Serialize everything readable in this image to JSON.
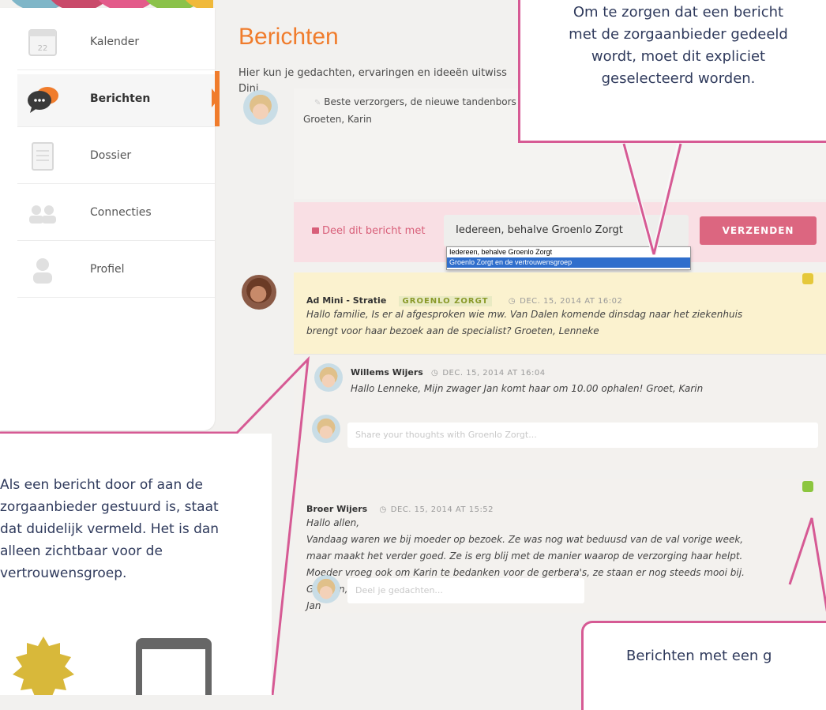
{
  "sidebar": {
    "items": [
      {
        "label": "Kalender",
        "icon": "calendar-icon",
        "active": false
      },
      {
        "label": "Berichten",
        "icon": "speech-bubbles-icon",
        "active": true
      },
      {
        "label": "Dossier",
        "icon": "notepad-icon",
        "active": false
      },
      {
        "label": "Connecties",
        "icon": "people-icon",
        "active": false
      },
      {
        "label": "Profiel",
        "icon": "person-icon",
        "active": false
      }
    ]
  },
  "calendar_icon_day": "22",
  "page": {
    "title": "Berichten",
    "description": "Hier kun je gedachten, ervaringen en ideeën uitwiss\nDini."
  },
  "compose": {
    "text_line1": "Beste verzorgers, de nieuwe tandenbors",
    "text_line2": "Groeten, Karin"
  },
  "share": {
    "label": "Deel dit bericht met",
    "selected": "Iedereen, behalve Groenlo Zorgt",
    "options": [
      "Iedereen, behalve Groenlo Zorgt",
      "Groenlo Zorgt en de vertrouwensgroep"
    ],
    "send_label": "VERZENDEN"
  },
  "messages": [
    {
      "author": "Ad Mini - Stratie",
      "tag": "GROENLO ZORGT",
      "timestamp": "DEC. 15, 2014 AT 16:02",
      "body_line1": "Hallo familie, Is er al afgesproken wie mw. Van Dalen komende dinsdag naar het ziekenhuis",
      "body_line2": "brengt voor haar bezoek aan de specialist? Groeten, Lenneke",
      "reply": {
        "author": "Willems Wijers",
        "timestamp": "DEC. 15, 2014 AT 16:04",
        "body": "Hallo Lenneke, Mijn zwager Jan komt haar om 10.00 ophalen! Groet, Karin"
      },
      "reply_placeholder": "Share your thoughts with Groenlo Zorgt..."
    },
    {
      "author": "Broer Wijers",
      "timestamp": "DEC. 15, 2014 AT 15:52",
      "body_lines": [
        "Hallo allen,",
        "Vandaag waren we bij moeder op bezoek. Ze was nog wat beduusd van de val vorige week,",
        "maar maakt het verder goed. Ze is erg blij met de manier waarop de verzorging haar helpt.",
        "Moeder vroeg ook om Karin te bedanken voor de gerbera's, ze staan er nog steeds mooi bij.",
        "Groeten,",
        "Jan"
      ],
      "reply_placeholder": "Deel je gedachten..."
    }
  ],
  "callouts": {
    "top_right": [
      "Om te zorgen dat een bericht",
      "met de zorgaanbieder gedeeld",
      "wordt, moet dit expliciet",
      "geselecteerd worden."
    ],
    "left": [
      "Als een bericht door of aan de",
      "zorgaanbieder gestuurd is, staat",
      "dat duidelijk vermeld. Het is dan",
      "alleen zichtbaar voor de",
      "vertrouwensgroep."
    ],
    "bottom_right": "Berichten met een g"
  },
  "colors": {
    "accent": "#f07c2c",
    "callout_border": "#d65a94",
    "send_button": "#dc6680",
    "share_bar": "#f9dfe4",
    "highlight_message": "#fbf2cf"
  }
}
